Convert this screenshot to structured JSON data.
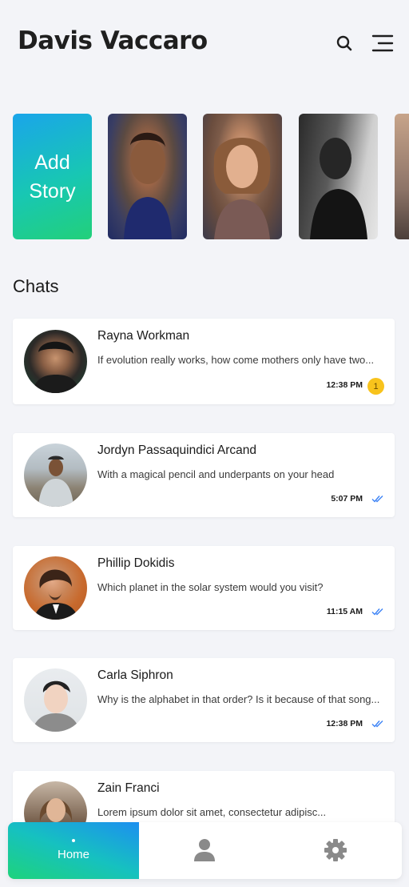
{
  "header": {
    "title": "Davis Vaccaro",
    "search_icon": "search-icon",
    "menu_icon": "menu-icon"
  },
  "stories": {
    "add_label": "Add\nStory"
  },
  "chats_title": "Chats",
  "chats": [
    {
      "name": "Rayna Workman",
      "message": "If evolution really works, how come mothers only have two...",
      "time": "12:38 PM",
      "unread": "1"
    },
    {
      "name": "Jordyn Passaquindici Arcand",
      "message": "With a magical pencil and underpants on your head",
      "time": "5:07 PM",
      "status_icon": "double-check-icon"
    },
    {
      "name": "Phillip Dokidis",
      "message": "Which planet in the solar system would you visit?",
      "time": "11:15 AM",
      "status_icon": "double-check-icon"
    },
    {
      "name": "Carla Siphron",
      "message": "Why is the alphabet in that order? Is it because of that song...",
      "time": "12:38 PM",
      "status_icon": "double-check-icon"
    },
    {
      "name": "Zain Franci",
      "message": "Lorem ipsum dolor sit amet, consectetur adipisc..."
    }
  ],
  "nav": {
    "home_label": "Home",
    "profile_icon": "profile-icon",
    "settings_icon": "settings-icon"
  },
  "colors": {
    "accent_blue": "#1d8ff0",
    "accent_green": "#1ed37c",
    "badge_yellow": "#f8c31c",
    "check_blue": "#3b82f6"
  }
}
